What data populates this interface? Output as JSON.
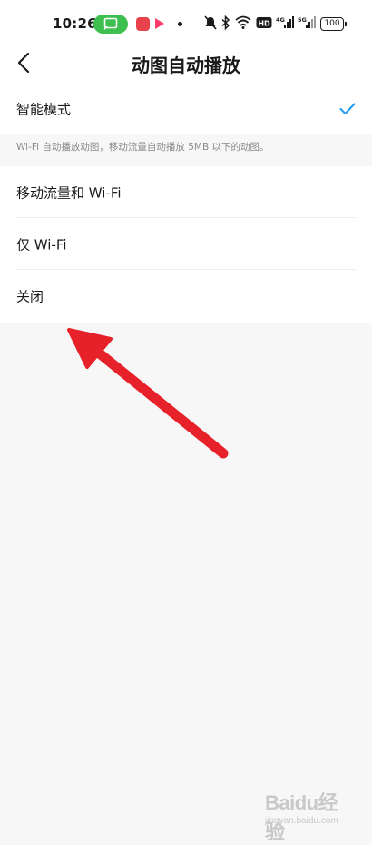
{
  "status_bar": {
    "time": "10:26",
    "battery": "100",
    "icons": [
      "screen-cast-icon",
      "app-notification-icon",
      "video-app-icon",
      "mute-icon",
      "bluetooth-icon",
      "wifi-icon",
      "hd-icon",
      "signal-4g-icon",
      "signal-5g-icon",
      "battery-icon"
    ]
  },
  "header": {
    "title": "动图自动播放",
    "back_icon": "chevron-left-icon"
  },
  "smart_mode": {
    "label": "智能模式",
    "selected": true,
    "check_icon": "check-icon",
    "description": "Wi-Fi 自动播放动图，移动流量自动播放 5MB 以下的动图。"
  },
  "options": [
    {
      "label": "移动流量和 Wi-Fi",
      "selected": false
    },
    {
      "label": "仅 Wi-Fi",
      "selected": false
    },
    {
      "label": "关闭",
      "selected": false
    }
  ],
  "colors": {
    "accent": "#2b9ef0",
    "arrow": "#e62129",
    "background": "#f7f7f7"
  },
  "watermark": {
    "text": "Baidu经验",
    "sub": "jingyan.baidu.com"
  }
}
